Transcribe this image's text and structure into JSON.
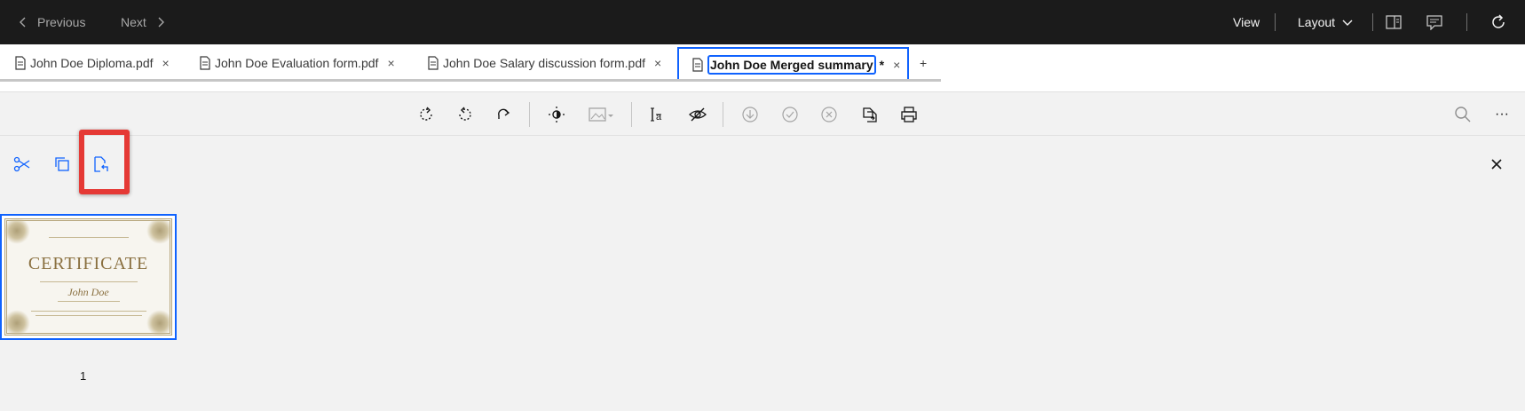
{
  "topbar": {
    "previous_label": "Previous",
    "next_label": "Next",
    "view_label": "View",
    "layout_label": "Layout"
  },
  "tabs": [
    {
      "label": "John Doe Diploma.pdf"
    },
    {
      "label": "John Doe Evaluation form.pdf"
    },
    {
      "label": "John Doe Salary discussion form.pdf"
    },
    {
      "label": "John Doe Merged summary",
      "dirty_marker": "*"
    }
  ],
  "add_tab_label": "+",
  "close_label": "×",
  "more_label": "···",
  "thumbnail": {
    "page_number": "1",
    "certificate_title": "CERTIFICATE",
    "certificate_name": "John Doe"
  },
  "colors": {
    "accent": "#0f62fe",
    "highlight": "#e53935",
    "topbar": "#1b1b1b"
  }
}
